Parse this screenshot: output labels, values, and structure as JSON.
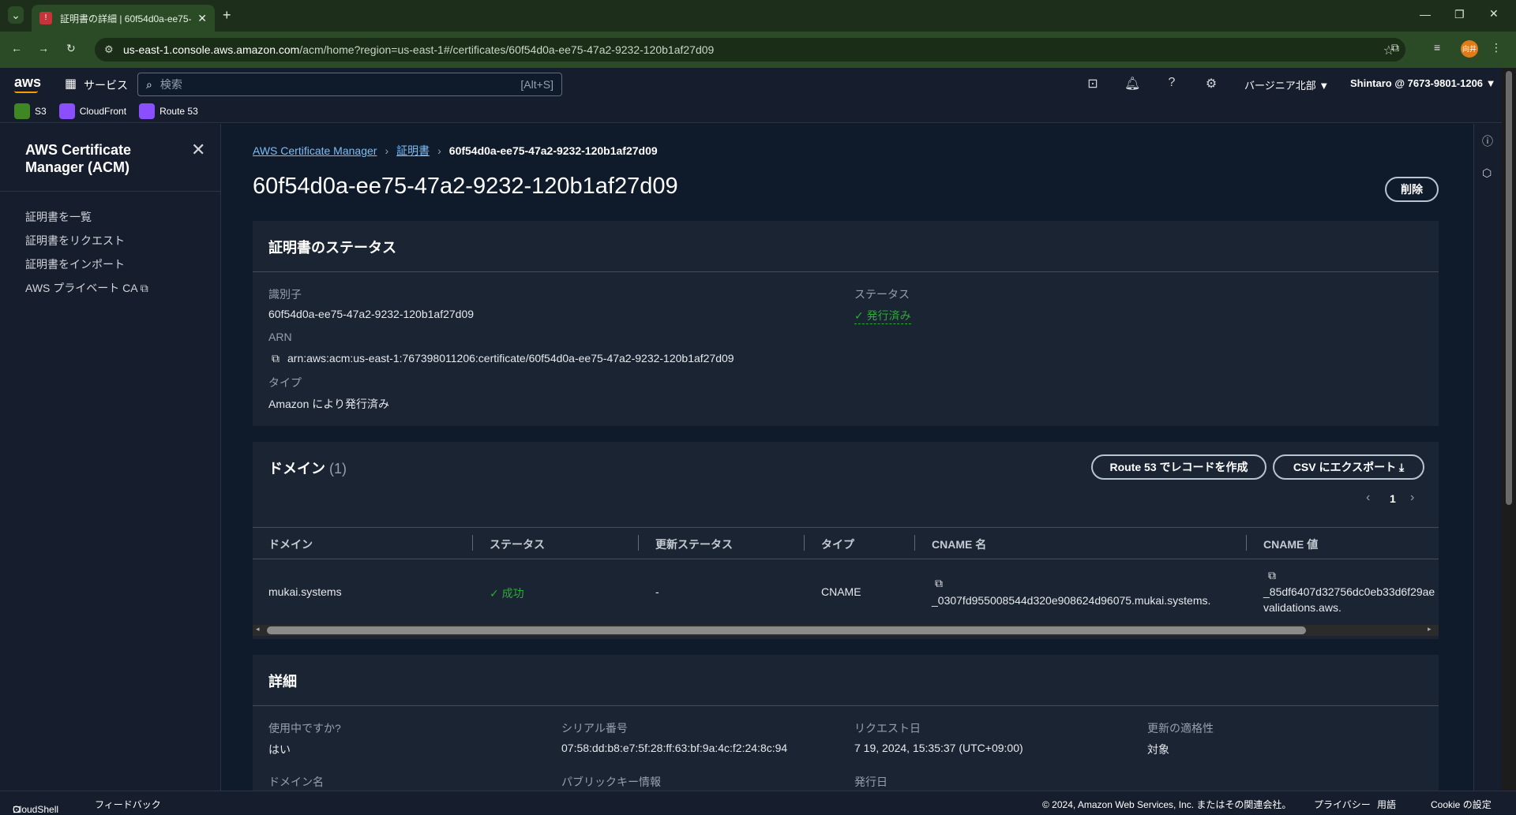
{
  "browser": {
    "tab_title": "証明書の詳細 | 60f54d0a-ee75-",
    "url_host": "us-east-1.console.aws.amazon.com",
    "url_path": "/acm/home?region=us-east-1#/certificates/60f54d0a-ee75-47a2-9232-120b1af27d09",
    "profile_initials": "向井"
  },
  "aws_header": {
    "logo": "aws",
    "services_label": "サービス",
    "search_placeholder": "検索",
    "search_shortcut": "[Alt+S]",
    "region": "バージニア北部 ▼",
    "account": "Shintaro @ 7673-9801-1206 ▼"
  },
  "favorites": [
    {
      "label": "S3",
      "color": "#3f8624"
    },
    {
      "label": "CloudFront",
      "color": "#8c4fff"
    },
    {
      "label": "Route 53",
      "color": "#8c4fff"
    }
  ],
  "sidebar": {
    "title": "AWS Certificate Manager (ACM)",
    "items": [
      {
        "label": "証明書を一覧"
      },
      {
        "label": "証明書をリクエスト"
      },
      {
        "label": "証明書をインポート"
      },
      {
        "label": "AWS プライベート CA"
      }
    ]
  },
  "breadcrumb": {
    "root": "AWS Certificate Manager",
    "mid": "証明書",
    "current": "60f54d0a-ee75-47a2-9232-120b1af27d09"
  },
  "page": {
    "title": "60f54d0a-ee75-47a2-9232-120b1af27d09",
    "delete_label": "削除"
  },
  "status_panel": {
    "heading": "証明書のステータス",
    "identifier_label": "識別子",
    "identifier": "60f54d0a-ee75-47a2-9232-120b1af27d09",
    "arn_label": "ARN",
    "arn": "arn:aws:acm:us-east-1:767398011206:certificate/60f54d0a-ee75-47a2-9232-120b1af27d09",
    "type_label": "タイプ",
    "type": "Amazon により発行済み",
    "status_label": "ステータス",
    "status": "発行済み"
  },
  "domains_panel": {
    "heading": "ドメイン",
    "count": "(1)",
    "route53_button": "Route 53 でレコードを作成",
    "csv_button": "CSV にエクスポート",
    "page_number": "1",
    "columns": [
      "ドメイン",
      "ステータス",
      "更新ステータス",
      "タイプ",
      "CNAME 名",
      "CNAME 値"
    ],
    "rows": [
      {
        "domain": "mukai.systems",
        "status": "成功",
        "renewal_status": "-",
        "type": "CNAME",
        "cname_name": "_0307fd955008544d320e908624d96075.mukai.systems.",
        "cname_value_line1": "_85df6407d32756dc0eb33d6f29ae",
        "cname_value_line2": "validations.aws."
      }
    ]
  },
  "details_panel": {
    "heading": "詳細",
    "in_use_label": "使用中ですか?",
    "in_use": "はい",
    "serial_label": "シリアル番号",
    "serial": "07:58:dd:b8:e7:5f:28:ff:63:bf:9a:4c:f2:24:8c:94",
    "requested_label": "リクエスト日",
    "requested": "7 19, 2024, 15:35:37 (UTC+09:00)",
    "renewal_label": "更新の適格性",
    "renewal": "対象",
    "domain_name_label": "ドメイン名",
    "public_key_label": "パブリックキー情報",
    "issued_label": "発行日"
  },
  "footer": {
    "cloudshell": "CloudShell",
    "feedback": "フィードバック",
    "copyright": "© 2024, Amazon Web Services, Inc. またはその関連会社。",
    "privacy": "プライバシー",
    "terms": "用語",
    "cookies": "Cookie の設定"
  }
}
